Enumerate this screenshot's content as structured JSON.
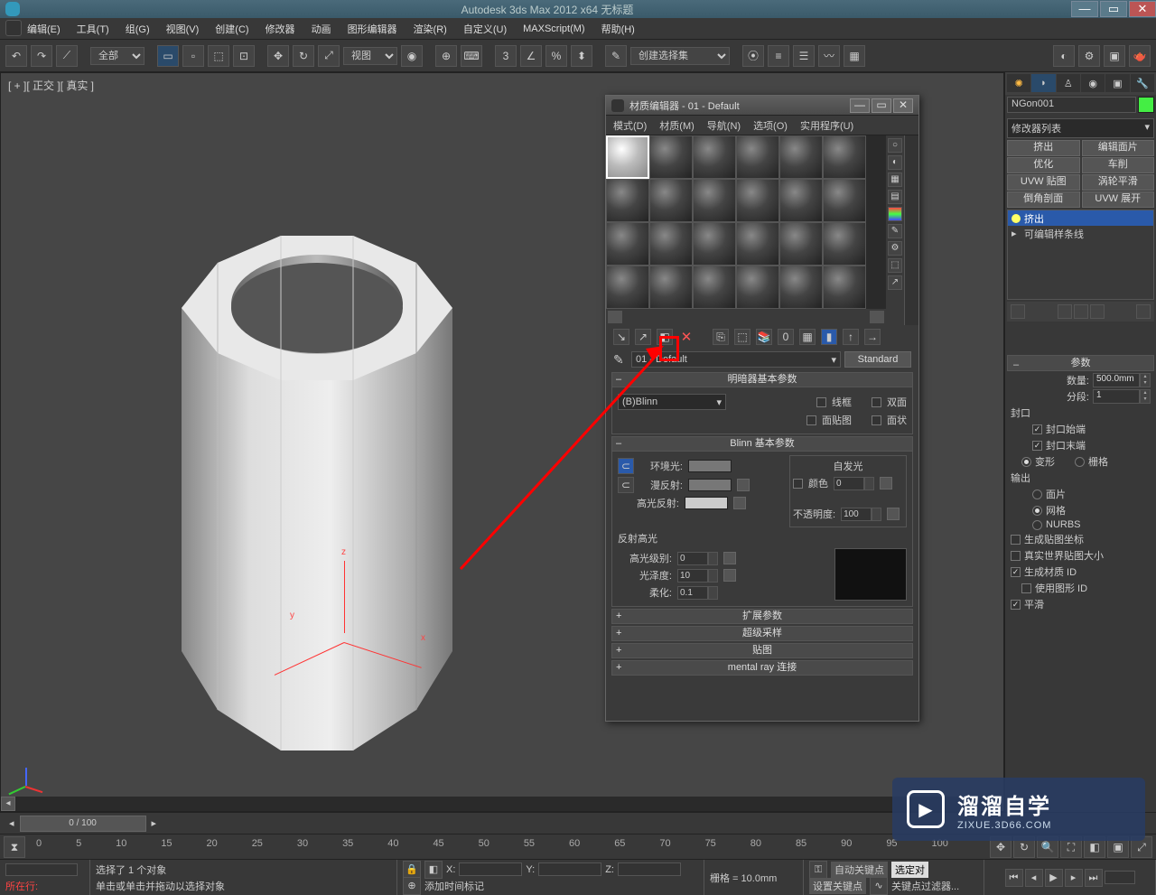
{
  "title": "Autodesk 3ds Max  2012 x64     无标题",
  "winbtns": {
    "min": "—",
    "max": "▭",
    "close": "✕"
  },
  "menu": [
    "编辑(E)",
    "工具(T)",
    "组(G)",
    "视图(V)",
    "创建(C)",
    "修改器",
    "动画",
    "图形编辑器",
    "渲染(R)",
    "自定义(U)",
    "MAXScript(M)",
    "帮助(H)"
  ],
  "toolbar": {
    "category": "全部",
    "viewlabel": "视图"
  },
  "viewport": {
    "label": "[ + ][ 正交 ][ 真实 ]",
    "axis": {
      "x": "x",
      "y": "y",
      "z": "z"
    }
  },
  "cmd": {
    "name": "NGon001",
    "modlist": "修改器列表",
    "btns": [
      [
        "挤出",
        "编辑面片"
      ],
      [
        "优化",
        "车削"
      ],
      [
        "UVW 贴图",
        "涡轮平滑"
      ],
      [
        "倒角剖面",
        "UVW 展开"
      ]
    ],
    "stack": [
      {
        "n": "挤出",
        "sel": true
      },
      {
        "n": "可编辑样条线",
        "sel": false
      }
    ],
    "roll_params": "参数",
    "amount_lbl": "数量:",
    "amount": "500.0mm",
    "segs_lbl": "分段:",
    "segs": "1",
    "cap_grp": "封口",
    "cap_start": "封口始端",
    "cap_end": "封口末端",
    "morph": "变形",
    "grid": "栅格",
    "out_grp": "输出",
    "out_opts": [
      "面片",
      "网格",
      "NURBS"
    ],
    "flags": [
      {
        "l": "生成贴图坐标",
        "c": false
      },
      {
        "l": "真实世界贴图大小",
        "c": false
      },
      {
        "l": "生成材质 ID",
        "c": true
      },
      {
        "l": "使用图形 ID",
        "c": false
      },
      {
        "l": "平滑",
        "c": true
      }
    ]
  },
  "me": {
    "title": "材质编辑器 - 01 - Default",
    "menu": [
      "模式(D)",
      "材质(M)",
      "导航(N)",
      "选项(O)",
      "实用程序(U)"
    ],
    "name": "01 - Default",
    "type": "Standard",
    "r1": "明暗器基本参数",
    "shader": "(B)Blinn",
    "opts": {
      "wire": "线框",
      "two": "双面",
      "facemap": "面贴图",
      "faceted": "面状"
    },
    "r2": "Blinn 基本参数",
    "ambient": "环境光:",
    "diffuse": "漫反射:",
    "specc": "高光反射:",
    "selfgrp": "自发光",
    "selfcolor": "颜色",
    "selfval": "0",
    "opac_lbl": "不透明度:",
    "opac": "100",
    "r3": "反射高光",
    "speclevel_lbl": "高光级别:",
    "speclevel": "0",
    "gloss_lbl": "光泽度:",
    "gloss": "10",
    "soft_lbl": "柔化:",
    "soft": "0.1",
    "rolls": [
      "扩展参数",
      "超级采样",
      "贴图",
      "mental ray 连接"
    ]
  },
  "time": {
    "pos": "0 / 100",
    "ticks": [
      "0",
      "5",
      "10",
      "15",
      "20",
      "25",
      "30",
      "35",
      "40",
      "45",
      "50",
      "55",
      "60",
      "65",
      "70",
      "75",
      "80",
      "85",
      "90",
      "95",
      "100"
    ]
  },
  "status": {
    "sel": "选择了 1 个对象",
    "hint": "单击或单击并拖动以选择对象",
    "row": "所在行:",
    "x": "X:",
    "y": "Y:",
    "z": "Z:",
    "grid": "栅格 = 10.0mm",
    "autokey": "自动关键点",
    "setkey": "设置关键点",
    "selset": "选定对",
    "keyfilter": "关键点过滤器...",
    "addtime": "添加时间标记"
  },
  "toolbar_selset": "创建选择集",
  "watermark": {
    "t1": "溜溜自学",
    "t2": "ZIXUE.3D66.COM"
  }
}
